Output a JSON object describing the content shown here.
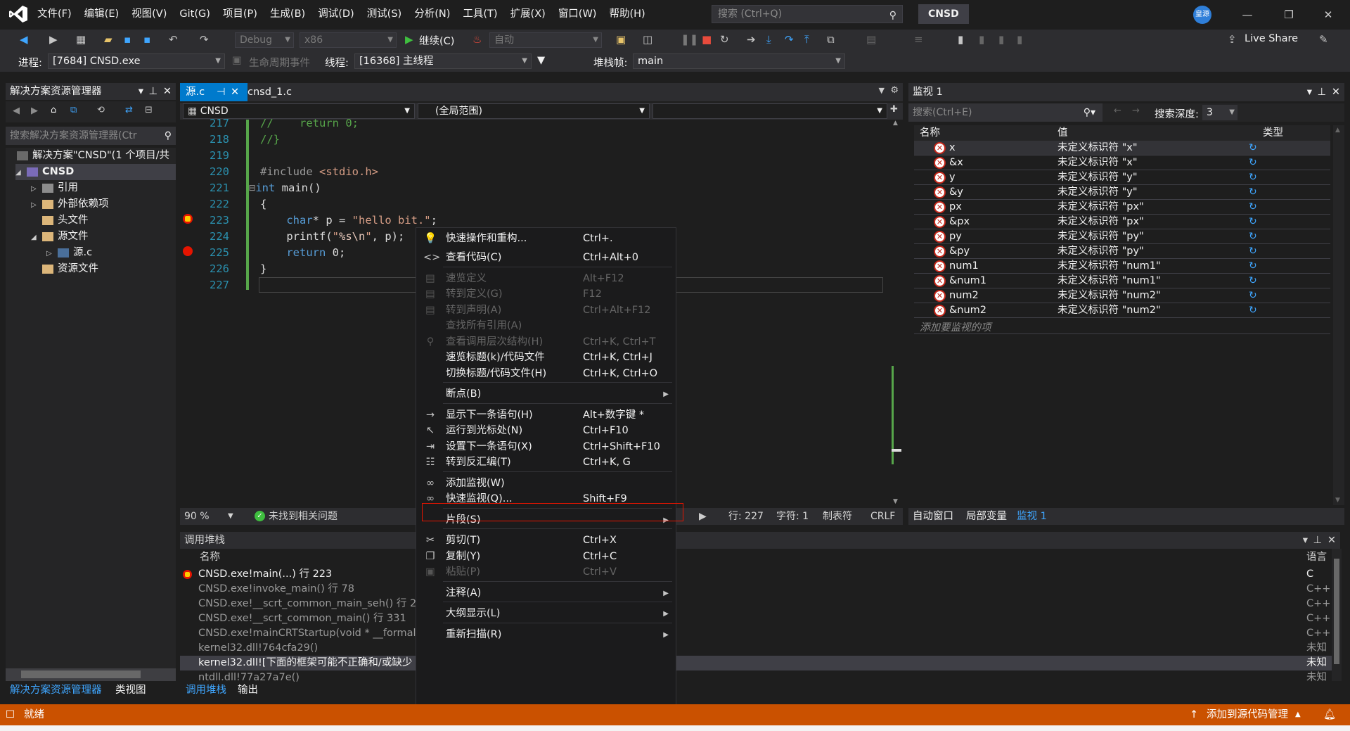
{
  "menu": [
    "文件(F)",
    "编辑(E)",
    "视图(V)",
    "Git(G)",
    "项目(P)",
    "生成(B)",
    "调试(D)",
    "测试(S)",
    "分析(N)",
    "工具(T)",
    "扩展(X)",
    "窗口(W)",
    "帮助(H)"
  ],
  "search_placeholder": "搜索 (Ctrl+Q)",
  "solution_name": "CNSD",
  "avatar_text": "皇源",
  "live_share": "Live Share",
  "toolbar": {
    "config": "Debug",
    "platform": "x86",
    "continue": "继续(C)",
    "auto": "自动"
  },
  "debugbar": {
    "process_label": "进程:",
    "process_value": "[7684] CNSD.exe",
    "lifecycle": "生命周期事件",
    "thread_label": "线程:",
    "thread_value": "[16368] 主线程",
    "stack_label": "堆栈帧:",
    "stack_value": "main"
  },
  "explorer": {
    "title": "解决方案资源管理器",
    "search": "搜索解决方案资源管理器(Ctr",
    "items": [
      "解决方案\"CNSD\"(1 个项目/共",
      "CNSD",
      "引用",
      "外部依赖项",
      "头文件",
      "源文件",
      "源.c",
      "资源文件"
    ],
    "tabs": [
      "解决方案资源管理器",
      "类视图"
    ]
  },
  "editor": {
    "tabs": [
      "源.c",
      "cnsd_1.c"
    ],
    "nav_project": "CNSD",
    "nav_scope": "(全局范围)",
    "line_numbers": [
      "217",
      "218",
      "219",
      "220",
      "221",
      "222",
      "223",
      "224",
      "225",
      "226",
      "227"
    ],
    "status": {
      "zoom": "90 %",
      "issues": "未找到相关问题",
      "line": "行: 227",
      "char": "字符: 1",
      "tab": "制表符",
      "eol": "CRLF"
    }
  },
  "watch": {
    "title": "监视 1",
    "search": "搜索(Ctrl+E)",
    "depth_label": "搜索深度:",
    "depth_value": "3",
    "headers": [
      "名称",
      "值",
      "类型"
    ],
    "rows": [
      {
        "name": "x",
        "value": "未定义标识符 \"x\""
      },
      {
        "name": "&x",
        "value": "未定义标识符 \"x\""
      },
      {
        "name": "y",
        "value": "未定义标识符 \"y\""
      },
      {
        "name": "&y",
        "value": "未定义标识符 \"y\""
      },
      {
        "name": "px",
        "value": "未定义标识符 \"px\""
      },
      {
        "name": "&px",
        "value": "未定义标识符 \"px\""
      },
      {
        "name": "py",
        "value": "未定义标识符 \"py\""
      },
      {
        "name": "&py",
        "value": "未定义标识符 \"py\""
      },
      {
        "name": "num1",
        "value": "未定义标识符 \"num1\""
      },
      {
        "name": "&num1",
        "value": "未定义标识符 \"num1\""
      },
      {
        "name": "num2",
        "value": "未定义标识符 \"num2\""
      },
      {
        "name": "&num2",
        "value": "未定义标识符 \"num2\""
      }
    ],
    "add_placeholder": "添加要监视的项",
    "tabs": [
      "自动窗口",
      "局部变量",
      "监视 1"
    ]
  },
  "callstack": {
    "title": "调用堆栈",
    "headers": [
      "名称",
      "语言"
    ],
    "rows": [
      {
        "name": "CNSD.exe!main(...) 行 223",
        "lang": "C"
      },
      {
        "name": "CNSD.exe!invoke_main() 行 78",
        "lang": "C++"
      },
      {
        "name": "CNSD.exe!__scrt_common_main_seh() 行 288",
        "lang": "C++"
      },
      {
        "name": "CNSD.exe!__scrt_common_main() 行 331",
        "lang": "C++"
      },
      {
        "name": "CNSD.exe!mainCRTStartup(void * __formal) 行",
        "lang": "C++"
      },
      {
        "name": "kernel32.dll!764cfa29()",
        "lang": "未知"
      },
      {
        "name": "kernel32.dll![下面的框架可能不正确和/或缺少",
        "lang": "未知"
      },
      {
        "name": "ntdll.dll!77a27a7e()",
        "lang": "未知"
      }
    ],
    "tabs": [
      "调用堆栈",
      "输出"
    ]
  },
  "context_menu": [
    {
      "label": "快速操作和重构...",
      "shortcut": "Ctrl+.",
      "icon": "💡",
      "disabled": false
    },
    {
      "label": "查看代码(C)",
      "shortcut": "Ctrl+Alt+0",
      "icon": "<>",
      "disabled": false
    },
    {
      "sep": true
    },
    {
      "label": "速览定义",
      "shortcut": "Alt+F12",
      "icon": "▤",
      "disabled": true
    },
    {
      "label": "转到定义(G)",
      "shortcut": "F12",
      "icon": "▤",
      "disabled": true
    },
    {
      "label": "转到声明(A)",
      "shortcut": "Ctrl+Alt+F12",
      "icon": "▤",
      "disabled": true
    },
    {
      "label": "查找所有引用(A)",
      "shortcut": "",
      "icon": "",
      "disabled": true
    },
    {
      "label": "查看调用层次结构(H)",
      "shortcut": "Ctrl+K, Ctrl+T",
      "icon": "⚲",
      "disabled": true
    },
    {
      "label": "速览标题(k)/代码文件",
      "shortcut": "Ctrl+K, Ctrl+J",
      "icon": "",
      "disabled": false
    },
    {
      "label": "切换标题/代码文件(H)",
      "shortcut": "Ctrl+K, Ctrl+O",
      "icon": "",
      "disabled": false
    },
    {
      "sep": true
    },
    {
      "label": "断点(B)",
      "shortcut": "",
      "icon": "",
      "disabled": false,
      "submenu": true
    },
    {
      "sep": true
    },
    {
      "label": "显示下一条语句(H)",
      "shortcut": "Alt+数字键 *",
      "icon": "→",
      "disabled": false
    },
    {
      "label": "运行到光标处(N)",
      "shortcut": "Ctrl+F10",
      "icon": "↖",
      "disabled": false
    },
    {
      "label": "设置下一条语句(X)",
      "shortcut": "Ctrl+Shift+F10",
      "icon": "⇥",
      "disabled": false
    },
    {
      "label": "转到反汇编(T)",
      "shortcut": "Ctrl+K, G",
      "icon": "☷",
      "disabled": false
    },
    {
      "sep": true
    },
    {
      "label": "添加监视(W)",
      "shortcut": "",
      "icon": "∞",
      "disabled": false
    },
    {
      "label": "快速监视(Q)...",
      "shortcut": "Shift+F9",
      "icon": "∞",
      "disabled": false
    },
    {
      "sep": true
    },
    {
      "label": "片段(S)",
      "shortcut": "",
      "icon": "",
      "disabled": false,
      "submenu": true
    },
    {
      "sep": true
    },
    {
      "label": "剪切(T)",
      "shortcut": "Ctrl+X",
      "icon": "✂",
      "disabled": false
    },
    {
      "label": "复制(Y)",
      "shortcut": "Ctrl+C",
      "icon": "❐",
      "disabled": false
    },
    {
      "label": "粘贴(P)",
      "shortcut": "Ctrl+V",
      "icon": "▣",
      "disabled": true
    },
    {
      "sep": true
    },
    {
      "label": "注释(A)",
      "shortcut": "",
      "icon": "",
      "disabled": false,
      "submenu": true
    },
    {
      "sep": true
    },
    {
      "label": "大纲显示(L)",
      "shortcut": "",
      "icon": "",
      "disabled": false,
      "submenu": true
    },
    {
      "sep": true
    },
    {
      "label": "重新扫描(R)",
      "shortcut": "",
      "icon": "",
      "disabled": false,
      "submenu": true
    }
  ],
  "statusbar": {
    "ready": "就绪",
    "add_source": "添加到源代码管理"
  }
}
